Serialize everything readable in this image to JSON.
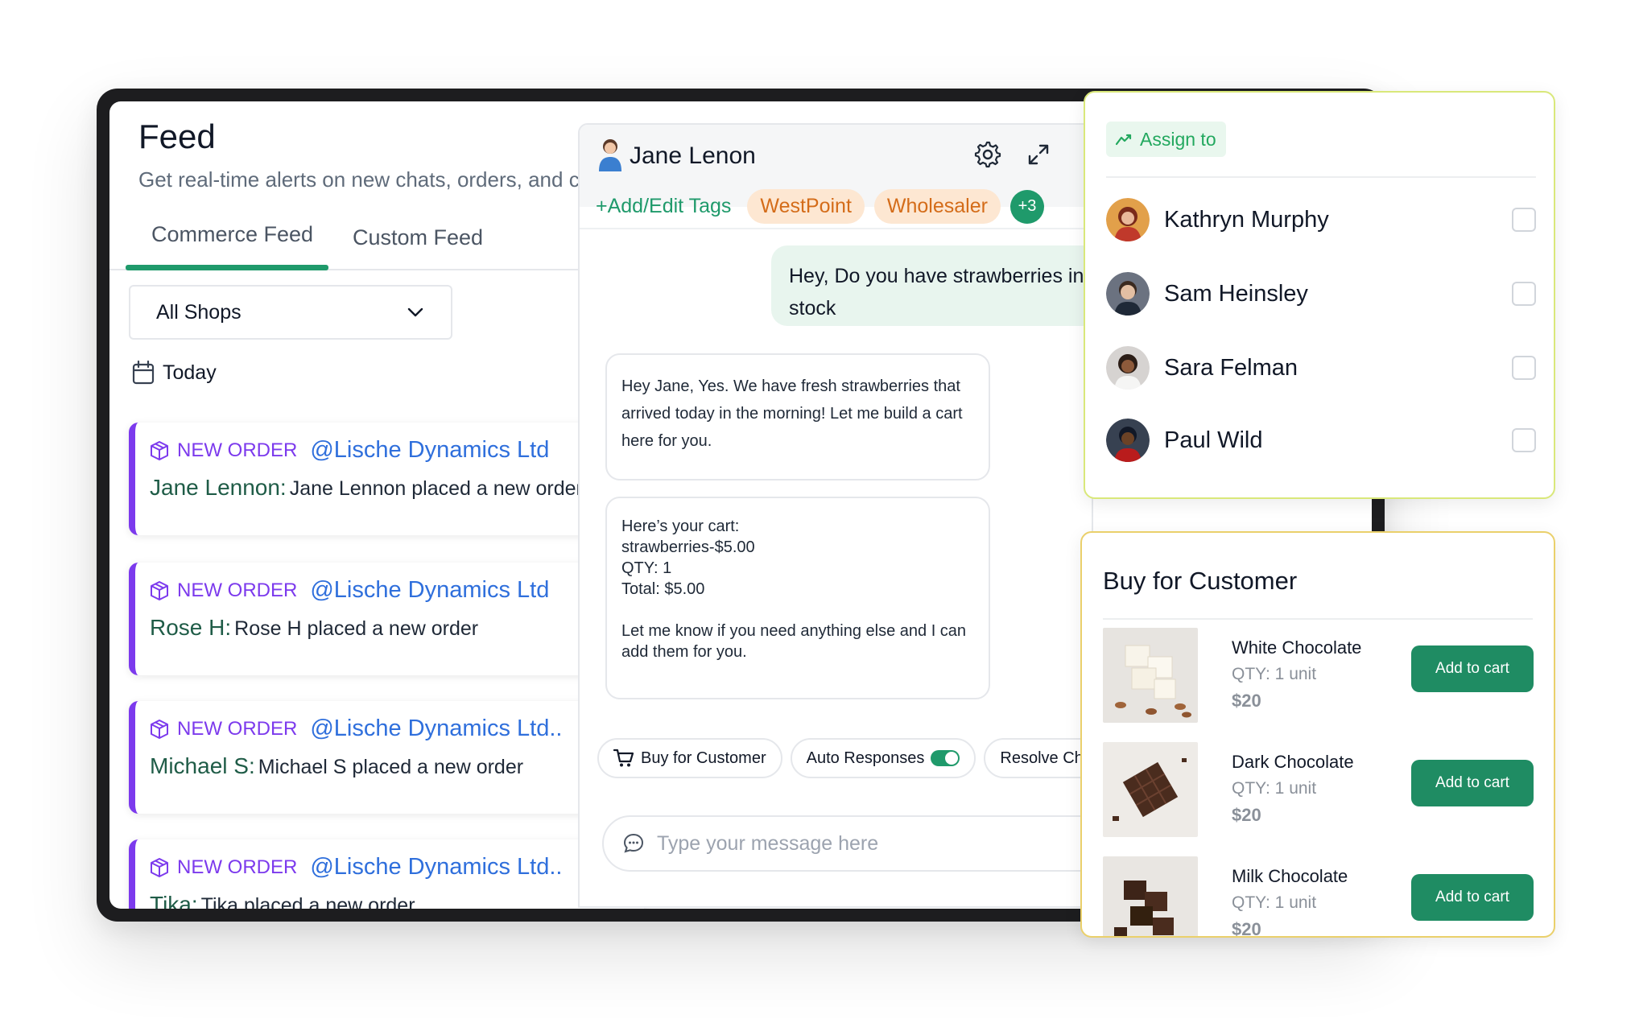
{
  "feed": {
    "title": "Feed",
    "subtitle": "Get real-time alerts on new chats, orders, and cu",
    "tabs": [
      {
        "label": "Commerce Feed",
        "active": true
      },
      {
        "label": "Custom Feed",
        "active": false
      }
    ],
    "shop_select": "All Shops",
    "date_label": "Today",
    "cards": [
      {
        "type": "NEW ORDER",
        "shop": "@Lische Dynamics Ltd",
        "name": "Jane Lennon:",
        "text": "Jane Lennon placed a new order"
      },
      {
        "type": "NEW ORDER",
        "shop": "@Lische Dynamics Ltd",
        "name": "Rose H:",
        "text": "Rose H placed a new order"
      },
      {
        "type": "NEW ORDER",
        "shop": "@Lische Dynamics Ltd..",
        "name": "Michael S:",
        "text": "Michael S placed a new order"
      },
      {
        "type": "NEW ORDER",
        "shop": "@Lische Dynamics Ltd..",
        "name": "Tika:",
        "text": "Tika placed a new order"
      }
    ],
    "accent_color": "#7c3aed"
  },
  "chat": {
    "contact_name": "Jane Lenon",
    "add_tags_label": "+Add/Edit Tags",
    "tags": [
      "WestPoint",
      "Wholesaler"
    ],
    "more_tags": "+3",
    "messages": {
      "outgoing": "Hey, Do you have strawberries in stock",
      "reply1": "Hey Jane, Yes. We have fresh strawberries that arrived today in the morning! Let me build a cart here for you.",
      "reply2_lines": [
        "Here’s your cart:",
        "strawberries-$5.00",
        "QTY: 1",
        "Total: $5.00",
        "",
        "Let me know if you need anything else and I can add them for you."
      ]
    },
    "actions": {
      "buy": "Buy for Customer",
      "auto": "Auto Responses",
      "auto_on": true,
      "resolve": "Resolve Chat"
    },
    "input_placeholder": "Type your message here"
  },
  "assign": {
    "button_label": "Assign to",
    "people": [
      "Kathryn Murphy",
      "Sam Heinsley",
      "Sara Felman",
      "Paul Wild"
    ]
  },
  "buy": {
    "title": "Buy for Customer",
    "products": [
      {
        "name": "White Chocolate",
        "qty": "QTY: 1 unit",
        "price": "$20",
        "button": "Add to cart"
      },
      {
        "name": "Dark Chocolate",
        "qty": "QTY: 1 unit",
        "price": "$20",
        "button": "Add to cart"
      },
      {
        "name": "Milk Chocolate",
        "qty": "QTY: 1 unit",
        "price": "$20",
        "button": "Add to cart"
      }
    ]
  },
  "colors": {
    "brand_green": "#1f9a6b",
    "tag_bg": "#fde7d2",
    "tag_text": "#d46c19",
    "link_blue": "#2f6fdc"
  },
  "icons": [
    "package-icon",
    "calendar-icon",
    "chevron-down-icon",
    "gear-icon",
    "expand-icon",
    "cart-icon",
    "chat-bubble-icon",
    "trend-icon"
  ]
}
